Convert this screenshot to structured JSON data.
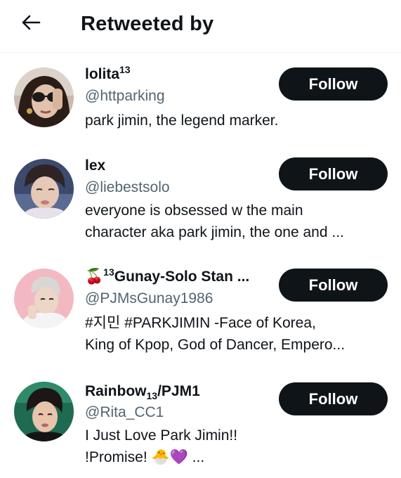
{
  "header": {
    "title": "Retweeted by",
    "back_icon": "arrow-left-icon"
  },
  "users": [
    {
      "display_name": "lolita",
      "name_suffix": "13",
      "handle": "@httparking",
      "bio_lines": [
        "park jimin, the legend marker."
      ],
      "follow_label": "Follow"
    },
    {
      "display_name": "lex",
      "handle": "@liebestsolo",
      "bio_lines": [
        "everyone is obsessed w the main",
        "character aka park jimin, the one and ..."
      ],
      "follow_label": "Follow"
    },
    {
      "name_prefix": "🍒",
      "name_sup": "13",
      "display_name": "Gunay-Solo Stan ...",
      "handle": "@PJMsGunay1986",
      "bio_lines": [
        "#지민 #PARKJIMIN -Face of Korea,",
        "King of  Kpop, God of Dancer, Empero..."
      ],
      "follow_label": "Follow"
    },
    {
      "display_name": "Rainbow",
      "name_sub": "13",
      "name_rest": "/PJM1",
      "handle": "@Rita_CC1",
      "bio_lines": [
        "I Just Love Park Jimin!!",
        "!Promise! 🐣💜          ..."
      ],
      "follow_label": "Follow"
    }
  ],
  "colors": {
    "follow_button_bg": "#0f1419",
    "handle_text": "#536471",
    "divider": "#eff3f4"
  }
}
